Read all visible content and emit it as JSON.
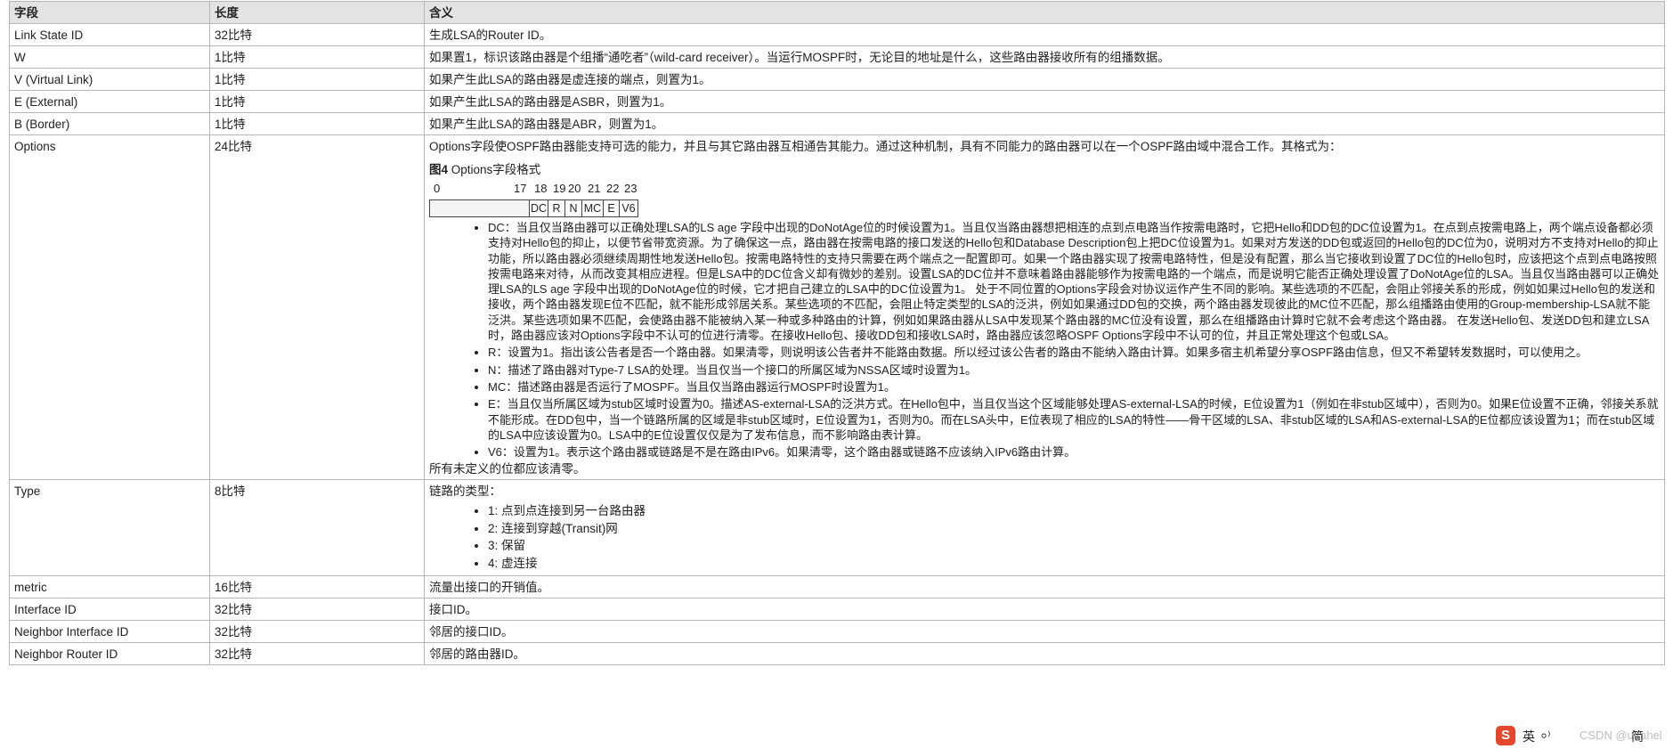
{
  "headers": [
    "字段",
    "长度",
    "含义"
  ],
  "rows": [
    {
      "field": "Link State ID",
      "length": "32比特",
      "meaning": "生成LSA的Router ID。"
    },
    {
      "field": "W",
      "length": "1比特",
      "meaning": "如果置1，标识该路由器是个组播“通吃者”（wild-card receiver）。当运行MOSPF时，无论目的地址是什么，这些路由器接收所有的组播数据。"
    },
    {
      "field": "V (Virtual Link)",
      "length": "1比特",
      "meaning": "如果产生此LSA的路由器是虚连接的端点，则置为1。"
    },
    {
      "field": "E (External)",
      "length": "1比特",
      "meaning": "如果产生此LSA的路由器是ASBR，则置为1。"
    },
    {
      "field": "B (Border)",
      "length": "1比特",
      "meaning": "如果产生此LSA的路由器是ABR，则置为1。"
    }
  ],
  "options": {
    "field": "Options",
    "length": "24比特",
    "intro": "Options字段使OSPF路由器能支持可选的能力，并且与其它路由器互相通告其能力。通过这种机制，具有不同能力的路由器可以在一个OSPF路由域中混合工作。其格式为：",
    "figure_label": "图4",
    "figure_title": "Options字段格式",
    "bit_numbers": [
      "0",
      "17",
      "18",
      "19",
      "20",
      "21",
      "22",
      "23"
    ],
    "bit_labels": [
      "DC",
      "R",
      "N",
      "MC",
      "E",
      "V6"
    ],
    "bullets": [
      "DC：当且仅当路由器可以正确处理LSA的LS age 字段中出现的DoNotAge位的时候设置为1。当且仅当路由器想把相连的点到点电路当作按需电路时，它把Hello和DD包的DC位设置为1。在点到点按需电路上，两个端点设备都必须支持对Hello包的抑止，以便节省带宽资源。为了确保这一点，路由器在按需电路的接口发送的Hello包和Database Description包上把DC位设置为1。如果对方发送的DD包或返回的Hello包的DC位为0，说明对方不支持对Hello的抑止功能，所以路由器必须继续周期性地发送Hello包。按需电路特性的支持只需要在两个端点之一配置即可。如果一个路由器实现了按需电路特性，但是没有配置，那么当它接收到设置了DC位的Hello包时，应该把这个点到点电路按照按需电路来对待，从而改变其相应进程。但是LSA中的DC位含义却有微妙的差别。设置LSA的DC位并不意味着路由器能够作为按需电路的一个端点，而是说明它能否正确处理设置了DoNotAge位的LSA。当且仅当路由器可以正确处理LSA的LS age 字段中出现的DoNotAge位的时候，它才把自己建立的LSA中的DC位设置为1。 处于不同位置的Options字段会对协议运作产生不同的影响。某些选项的不匹配，会阻止邻接关系的形成，例如如果过Hello包的发送和接收，两个路由器发现E位不匹配，就不能形成邻居关系。某些选项的不匹配，会阻止特定类型的LSA的泛洪，例如如果通过DD包的交换，两个路由器发现彼此的MC位不匹配，那么组播路由使用的Group-membership-LSA就不能泛洪。某些选项如果不匹配，会使路由器不能被纳入某一种或多种路由的计算，例如如果路由器从LSA中发现某个路由器的MC位没有设置，那么在组播路由计算时它就不会考虑这个路由器。 在发送Hello包、发送DD包和建立LSA时，路由器应该对Options字段中不认可的位进行清零。在接收Hello包、接收DD包和接收LSA时，路由器应该忽略OSPF Options字段中不认可的位，并且正常处理这个包或LSA。",
      "R：设置为1。指出该公告者是否一个路由器。如果清零，则说明该公告者并不能路由数据。所以经过该公告者的路由不能纳入路由计算。如果多宿主机希望分享OSPF路由信息，但又不希望转发数据时，可以使用之。",
      "N：描述了路由器对Type-7 LSA的处理。当且仅当一个接口的所属区域为NSSA区域时设置为1。",
      "MC：描述路由器是否运行了MOSPF。当且仅当路由器运行MOSPF时设置为1。",
      "E：当且仅当所属区域为stub区域时设置为0。描述AS-external-LSA的泛洪方式。在Hello包中，当且仅当这个区域能够处理AS-external-LSA的时候，E位设置为1（例如在非stub区域中），否则为0。如果E位设置不正确，邻接关系就不能形成。在DD包中，当一个链路所属的区域是非stub区域时，E位设置为1，否则为0。而在LSA头中，E位表现了相应的LSA的特性——骨干区域的LSA、非stub区域的LSA和AS-external-LSA的E位都应该设置为1；而在stub区域的LSA中应该设置为0。LSA中的E位设置仅仅是为了发布信息，而不影响路由表计算。",
      "V6：设置为1。表示这个路由器或链路是不是在路由IPv6。如果清零，这个路由器或链路不应该纳入IPv6路由计算。"
    ],
    "closing": "所有未定义的位都应该清零。"
  },
  "type_row": {
    "field": "Type",
    "length": "8比特",
    "intro": "链路的类型：",
    "items": [
      "1: 点到点连接到另一台路由器",
      "2: 连接到穿越(Transit)网",
      "3: 保留",
      "4: 虚连接"
    ]
  },
  "tail_rows": [
    {
      "field": "metric",
      "length": "16比特",
      "meaning": "流量出接口的开销值。"
    },
    {
      "field": "Interface ID",
      "length": "32比特",
      "meaning": "接口ID。"
    },
    {
      "field": "Neighbor Interface ID",
      "length": "32比特",
      "meaning": "邻居的接口ID。"
    },
    {
      "field": "Neighbor Router ID",
      "length": "32比特",
      "meaning": "邻居的路由器ID。"
    }
  ],
  "toolbar": {
    "logo": "S",
    "items": [
      "英",
      "⸰⁾",
      "简"
    ],
    "faded": "CSDN @uirahel"
  }
}
